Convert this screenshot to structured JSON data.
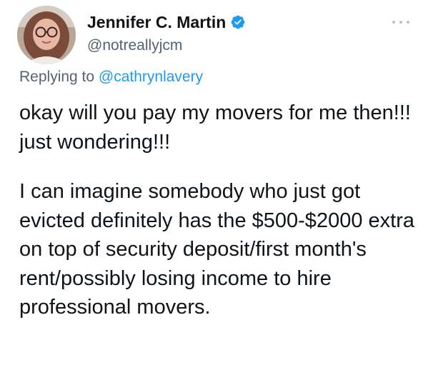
{
  "author": {
    "display_name": "Jennifer C. Martin",
    "handle": "@notreallyjcm",
    "verified": true
  },
  "reply": {
    "prefix": "Replying to",
    "mention": "@cathrynlavery"
  },
  "tweet": {
    "paragraph_1": "okay will you pay my movers for me then!!! just wondering!!!",
    "paragraph_2": "I can imagine somebody who just got evicted definitely has the $500-$2000 extra on top of security deposit/first month's rent/possibly losing income to hire professional movers."
  },
  "colors": {
    "text": "#0f1419",
    "secondary": "#536471",
    "accent": "#1d9bf0"
  },
  "icons": {
    "verified": "verified-badge-icon",
    "more": "more-options-icon"
  }
}
